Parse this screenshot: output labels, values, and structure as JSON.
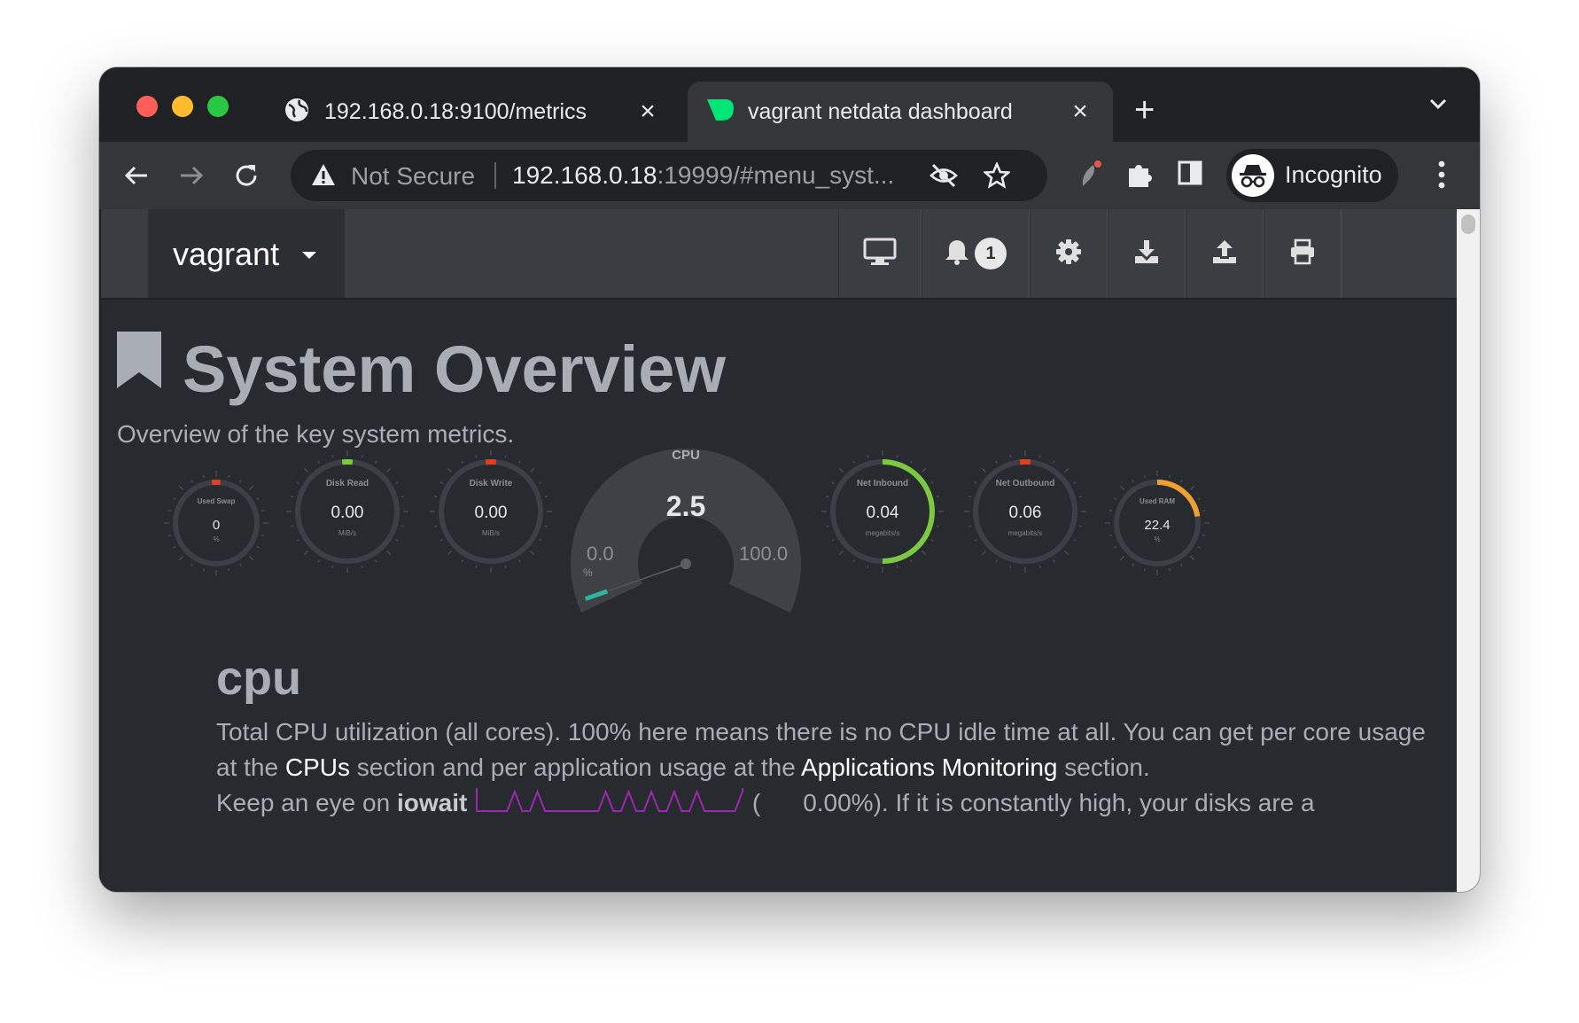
{
  "browser": {
    "tabs": [
      {
        "title": "192.168.0.18:9100/metrics",
        "icon": "globe-icon",
        "active": false
      },
      {
        "title": "vagrant netdata dashboard",
        "icon": "netdata-icon",
        "active": true
      }
    ],
    "security_label": "Not Secure",
    "url_host": "192.168.0.18",
    "url_rest": ":19999/#menu_syst...",
    "profile_label": "Incognito"
  },
  "navbar": {
    "host": "vagrant",
    "alarm_count": "1"
  },
  "overview": {
    "title": "System Overview",
    "subtitle": "Overview of the key system metrics."
  },
  "gauges": [
    {
      "id": "used-swap",
      "title": "Used Swap",
      "value": "0",
      "unit": "%",
      "fraction": 0.0,
      "marker_color": "#e04020"
    },
    {
      "id": "disk-read",
      "title": "Disk Read",
      "value": "0.00",
      "unit": "MiB/s",
      "fraction": 0.0,
      "marker_color": "#7cc940"
    },
    {
      "id": "disk-write",
      "title": "Disk Write",
      "value": "0.00",
      "unit": "MiB/s",
      "fraction": 0.0,
      "marker_color": "#e04020"
    },
    {
      "id": "net-inbound",
      "title": "Net Inbound",
      "value": "0.04",
      "unit": "megabits/s",
      "fraction": 0.5,
      "marker_color": "#7cc940"
    },
    {
      "id": "net-outbound",
      "title": "Net Outbound",
      "value": "0.06",
      "unit": "megabits/s",
      "fraction": 0.0,
      "marker_color": "#e04020"
    },
    {
      "id": "used-ram",
      "title": "Used RAM",
      "value": "22.4",
      "unit": "%",
      "fraction": 0.224,
      "marker_color": "#f0a030"
    }
  ],
  "cpu_gauge": {
    "title": "CPU",
    "value": "2.5",
    "min_label": "0.0",
    "max_label": "100.0",
    "unit": "%",
    "percent": 2.5
  },
  "cpu_section": {
    "title": "cpu",
    "line1": "Total CPU utilization (all cores). 100% here means there is no CPU idle time at all. You can get per core usage",
    "line2_a": "at the ",
    "line2_link1": "CPUs",
    "line2_b": " section and per application usage at the ",
    "line2_link2": "Applications Monitoring",
    "line2_c": " section.",
    "line3_a": "Keep an eye on ",
    "line3_bold": "iowait",
    "line3_open": "(",
    "line3_value": "0.00%",
    "line3_b": "). If it is constantly high, your disks are a",
    "sparkline": [
      0,
      0,
      0,
      0,
      0,
      1,
      0,
      0,
      1,
      0,
      0,
      0,
      0,
      0,
      0,
      0,
      0,
      1,
      0,
      0,
      1,
      0,
      0,
      1,
      0,
      0,
      1,
      0,
      0,
      1,
      0,
      0,
      0,
      0,
      0,
      1
    ]
  },
  "colors": {
    "sparkline": "#9c27b0",
    "cpu_needle": "#2bb5a0",
    "ram_arc": "#f0a030",
    "net_in_arc": "#7cc940"
  }
}
